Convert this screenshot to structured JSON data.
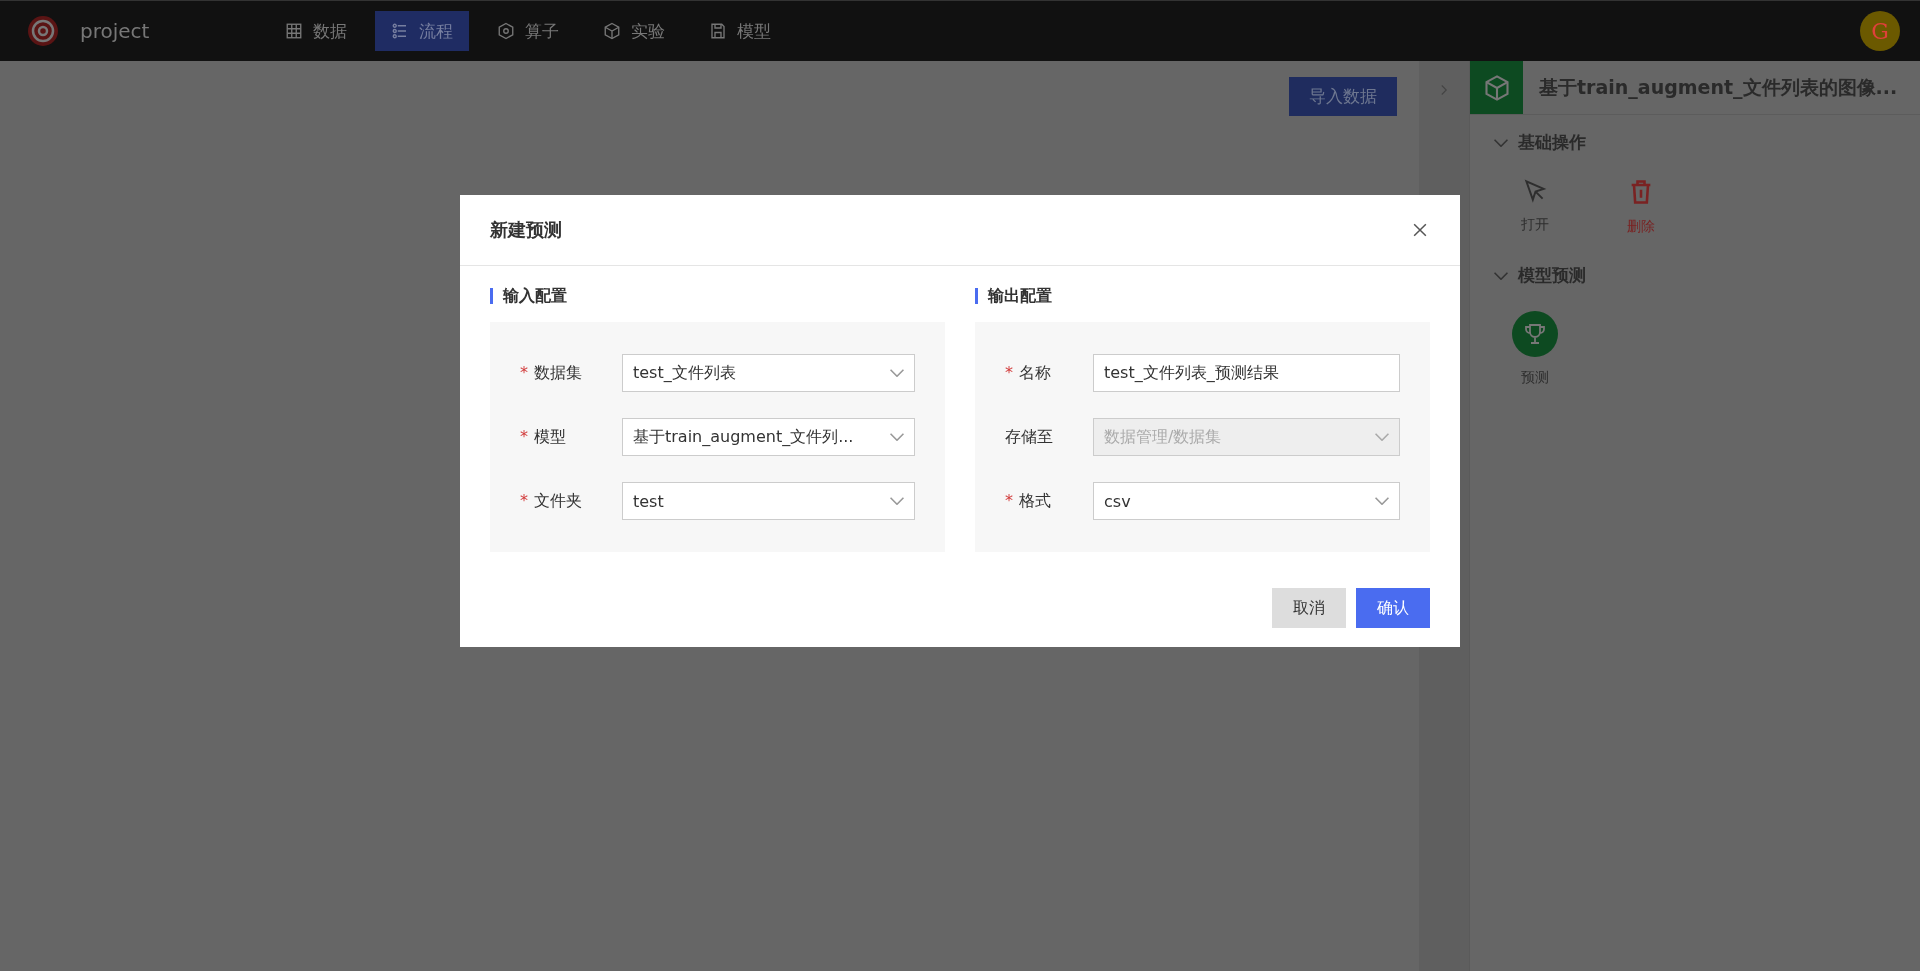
{
  "app": {
    "name": "project",
    "avatar": "G"
  },
  "nav": [
    {
      "label": "数据",
      "kind": "table",
      "selected": false
    },
    {
      "label": "流程",
      "kind": "flow",
      "selected": true
    },
    {
      "label": "算子",
      "kind": "hex",
      "selected": false
    },
    {
      "label": "实验",
      "kind": "cube",
      "selected": false
    },
    {
      "label": "模型",
      "kind": "save",
      "selected": false
    }
  ],
  "canvas": {
    "import_button": "导入数据"
  },
  "panel": {
    "title": "基于train_augment_文件列表的图像...",
    "sections": [
      {
        "title": "基础操作",
        "expanded": true,
        "actions": [
          {
            "label": "打开",
            "kind": "open"
          },
          {
            "label": "删除",
            "kind": "delete"
          }
        ]
      },
      {
        "title": "模型预测",
        "expanded": true,
        "actions": [
          {
            "label": "预测",
            "kind": "predict"
          }
        ]
      }
    ]
  },
  "dialog": {
    "title": "新建预测",
    "groups": [
      {
        "title": "输入配置",
        "fields": [
          {
            "label": "数据集",
            "mark": "*",
            "kind": "select",
            "value": "test_文件列表",
            "disabled": false
          },
          {
            "label": "模型",
            "mark": "*",
            "kind": "select",
            "value": "基于train_augment_文件列...",
            "disabled": false
          },
          {
            "label": "文件夹",
            "mark": "*",
            "kind": "select",
            "value": "test",
            "disabled": false
          }
        ]
      },
      {
        "title": "输出配置",
        "fields": [
          {
            "label": "名称",
            "mark": "*",
            "kind": "input",
            "value": "test_文件列表_预测结果",
            "disabled": false
          },
          {
            "label": "存储至",
            "kind": "select",
            "value": "数据管理/数据集",
            "disabled": true
          },
          {
            "label": "格式",
            "mark": "*",
            "kind": "select",
            "value": "csv",
            "disabled": false
          }
        ]
      }
    ],
    "cancel": "取消",
    "confirm": "确认"
  }
}
